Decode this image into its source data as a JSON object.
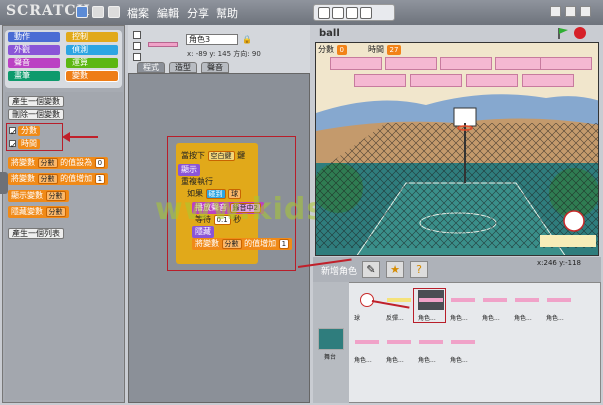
{
  "app": {
    "logo_text": "SCRATCH",
    "menu": [
      "檔案",
      "編輯",
      "分享",
      "幫助"
    ],
    "brand_color": "#6e737c"
  },
  "palette": {
    "categories": [
      {
        "label": "動作",
        "color": "#4a6cd4"
      },
      {
        "label": "控制",
        "color": "#e1a91a"
      },
      {
        "label": "外觀",
        "color": "#8a55d7"
      },
      {
        "label": "偵測",
        "color": "#2ca5e2"
      },
      {
        "label": "聲音",
        "color": "#bb42c3"
      },
      {
        "label": "運算",
        "color": "#5cb712"
      },
      {
        "label": "畫筆",
        "color": "#0e9a6c"
      },
      {
        "label": "變數",
        "color": "#ee7d16"
      }
    ],
    "make_var_button": "產生一個變數",
    "delete_var_button": "刪除一個變數",
    "variables": [
      "分數",
      "時間"
    ],
    "blocks": {
      "set_var": {
        "prefix": "將變數",
        "var": "分數",
        "mid": "的值設為",
        "val": "0"
      },
      "change_var": {
        "prefix": "將變數",
        "var": "分數",
        "mid": "的值增加",
        "val": "1"
      },
      "show_var": {
        "prefix": "顯示變數",
        "var": "分數"
      },
      "hide_var": {
        "prefix": "隱藏變數",
        "var": "分數"
      }
    },
    "make_list_button": "產生一個列表"
  },
  "sprite": {
    "name": "角色3",
    "x_label": "x:",
    "x": "-89",
    "y_label": "y:",
    "y": "145",
    "dir_label": "方向:",
    "dir": "90",
    "tabs": [
      "程式",
      "造型",
      "聲音"
    ]
  },
  "script": {
    "hat": {
      "text": "當按下",
      "key": "空白鍵",
      "suffix": "鍵"
    },
    "show": "顯示",
    "forever": "重複執行",
    "if_text": "如果",
    "touching": "碰到",
    "touching_target": "球",
    "play_sound": "播放聲音",
    "sound_name": "錄音中2",
    "wait": "等待",
    "wait_val": "0.1",
    "wait_unit": "秒",
    "hide": "隱藏",
    "change_var": {
      "prefix": "將變數",
      "var": "分數",
      "mid": "的值增加",
      "val": "1"
    }
  },
  "stage": {
    "title": "ball",
    "score_label": "分數",
    "score_value": "0",
    "time_label": "時間",
    "time_value": "27",
    "mouse_x_label": "x:",
    "mouse_x": "246",
    "mouse_y_label": "y:",
    "mouse_y": "-118"
  },
  "sprites_bar": {
    "new_sprite_label": "新增角色"
  },
  "sprite_list": [
    {
      "label": "球",
      "kind": "ball"
    },
    {
      "label": "反彈...",
      "kind": "yellow"
    },
    {
      "label": "角色...",
      "kind": "pink",
      "selected": true
    },
    {
      "label": "角色...",
      "kind": "pink"
    },
    {
      "label": "角色...",
      "kind": "pink"
    },
    {
      "label": "角色...",
      "kind": "pink"
    },
    {
      "label": "角色...",
      "kind": "pink"
    },
    {
      "label": "角色...",
      "kind": "pink"
    },
    {
      "label": "角色...",
      "kind": "pink"
    },
    {
      "label": "角色...",
      "kind": "pink"
    },
    {
      "label": "角色...",
      "kind": "pink"
    }
  ],
  "stage_thumb_label": "舞台",
  "watermark": "www.kidscod.cn"
}
